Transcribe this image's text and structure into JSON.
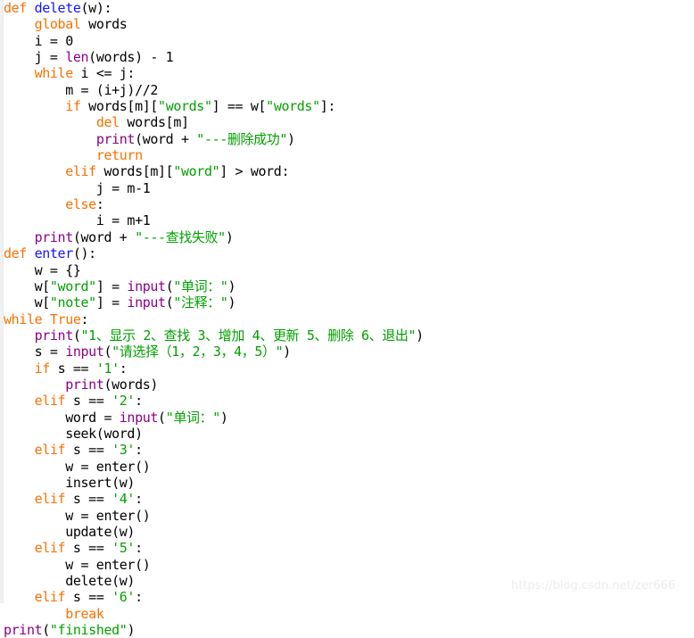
{
  "editor": {
    "background_color": "#ffffff",
    "language": "python",
    "font_size_px": 15,
    "line_height_px": 18.35
  },
  "palette": {
    "keyword": "#f77100",
    "function_name": "#1414ff",
    "builtin": "#8a008a",
    "string": "#00a000",
    "plain": "#000000",
    "watermark": "#ededed"
  },
  "watermark": {
    "text": "https://blog.csdn.net/zer666"
  },
  "code": {
    "lines": [
      {
        "n": 1,
        "tokens": [
          {
            "c": "kw",
            "t": "def"
          },
          {
            "c": "plain",
            "t": " "
          },
          {
            "c": "fname",
            "t": "delete"
          },
          {
            "c": "plain",
            "t": "(w):"
          }
        ]
      },
      {
        "n": 2,
        "tokens": [
          {
            "c": "plain",
            "t": "    "
          },
          {
            "c": "kw",
            "t": "global"
          },
          {
            "c": "plain",
            "t": " words"
          }
        ]
      },
      {
        "n": 3,
        "tokens": [
          {
            "c": "plain",
            "t": "    i = 0"
          }
        ]
      },
      {
        "n": 4,
        "tokens": [
          {
            "c": "plain",
            "t": "    j = "
          },
          {
            "c": "builtin",
            "t": "len"
          },
          {
            "c": "plain",
            "t": "(words) - 1"
          }
        ]
      },
      {
        "n": 5,
        "tokens": [
          {
            "c": "plain",
            "t": "    "
          },
          {
            "c": "kw",
            "t": "while"
          },
          {
            "c": "plain",
            "t": " i <= j:"
          }
        ]
      },
      {
        "n": 6,
        "tokens": [
          {
            "c": "plain",
            "t": "        m = (i+j)//2"
          }
        ]
      },
      {
        "n": 7,
        "tokens": [
          {
            "c": "plain",
            "t": "        "
          },
          {
            "c": "kw",
            "t": "if"
          },
          {
            "c": "plain",
            "t": " words[m]["
          },
          {
            "c": "str",
            "t": "\"words\""
          },
          {
            "c": "plain",
            "t": "] == w["
          },
          {
            "c": "str",
            "t": "\"words\""
          },
          {
            "c": "plain",
            "t": "]:"
          }
        ]
      },
      {
        "n": 8,
        "tokens": [
          {
            "c": "plain",
            "t": "            "
          },
          {
            "c": "kw",
            "t": "del"
          },
          {
            "c": "plain",
            "t": " words[m]"
          }
        ]
      },
      {
        "n": 9,
        "tokens": [
          {
            "c": "plain",
            "t": "            "
          },
          {
            "c": "builtin",
            "t": "print"
          },
          {
            "c": "plain",
            "t": "(word + "
          },
          {
            "c": "str",
            "t": "\"---删除成功\""
          },
          {
            "c": "plain",
            "t": ")"
          }
        ]
      },
      {
        "n": 10,
        "tokens": [
          {
            "c": "plain",
            "t": "            "
          },
          {
            "c": "kw",
            "t": "return"
          }
        ]
      },
      {
        "n": 11,
        "tokens": [
          {
            "c": "plain",
            "t": "        "
          },
          {
            "c": "kw",
            "t": "elif"
          },
          {
            "c": "plain",
            "t": " words[m]["
          },
          {
            "c": "str",
            "t": "\"word\""
          },
          {
            "c": "plain",
            "t": "] > word:"
          }
        ]
      },
      {
        "n": 12,
        "tokens": [
          {
            "c": "plain",
            "t": "            j = m-1"
          }
        ]
      },
      {
        "n": 13,
        "tokens": [
          {
            "c": "plain",
            "t": "        "
          },
          {
            "c": "kw",
            "t": "else"
          },
          {
            "c": "plain",
            "t": ":"
          }
        ]
      },
      {
        "n": 14,
        "tokens": [
          {
            "c": "plain",
            "t": "            i = m+1"
          }
        ]
      },
      {
        "n": 15,
        "tokens": [
          {
            "c": "plain",
            "t": "    "
          },
          {
            "c": "builtin",
            "t": "print"
          },
          {
            "c": "plain",
            "t": "(word + "
          },
          {
            "c": "str",
            "t": "\"---查找失败\""
          },
          {
            "c": "plain",
            "t": ")"
          }
        ]
      },
      {
        "n": 16,
        "tokens": [
          {
            "c": "kw",
            "t": "def"
          },
          {
            "c": "plain",
            "t": " "
          },
          {
            "c": "fname",
            "t": "enter"
          },
          {
            "c": "plain",
            "t": "():"
          }
        ]
      },
      {
        "n": 17,
        "tokens": [
          {
            "c": "plain",
            "t": "    w = {}"
          }
        ]
      },
      {
        "n": 18,
        "tokens": [
          {
            "c": "plain",
            "t": "    w["
          },
          {
            "c": "str",
            "t": "\"word\""
          },
          {
            "c": "plain",
            "t": "] = "
          },
          {
            "c": "builtin",
            "t": "input"
          },
          {
            "c": "plain",
            "t": "("
          },
          {
            "c": "str",
            "t": "\"单词：\""
          },
          {
            "c": "plain",
            "t": ")"
          }
        ]
      },
      {
        "n": 19,
        "tokens": [
          {
            "c": "plain",
            "t": "    w["
          },
          {
            "c": "str",
            "t": "\"note\""
          },
          {
            "c": "plain",
            "t": "] = "
          },
          {
            "c": "builtin",
            "t": "input"
          },
          {
            "c": "plain",
            "t": "("
          },
          {
            "c": "str",
            "t": "\"注释：\""
          },
          {
            "c": "plain",
            "t": ")"
          }
        ]
      },
      {
        "n": 20,
        "tokens": [
          {
            "c": "kw",
            "t": "while"
          },
          {
            "c": "plain",
            "t": " "
          },
          {
            "c": "kw",
            "t": "True"
          },
          {
            "c": "plain",
            "t": ":"
          }
        ]
      },
      {
        "n": 21,
        "tokens": [
          {
            "c": "plain",
            "t": "    "
          },
          {
            "c": "builtin",
            "t": "print"
          },
          {
            "c": "plain",
            "t": "("
          },
          {
            "c": "str",
            "t": "\"1、显示 2、查找 3、增加 4、更新 5、删除 6、退出\""
          },
          {
            "c": "plain",
            "t": ")"
          }
        ]
      },
      {
        "n": 22,
        "tokens": [
          {
            "c": "plain",
            "t": "    s = "
          },
          {
            "c": "builtin",
            "t": "input"
          },
          {
            "c": "plain",
            "t": "("
          },
          {
            "c": "str",
            "t": "\"请选择（1，2，3，4，5）\""
          },
          {
            "c": "plain",
            "t": ")"
          }
        ]
      },
      {
        "n": 23,
        "tokens": [
          {
            "c": "plain",
            "t": "    "
          },
          {
            "c": "kw",
            "t": "if"
          },
          {
            "c": "plain",
            "t": " s == "
          },
          {
            "c": "str",
            "t": "'1'"
          },
          {
            "c": "plain",
            "t": ":"
          }
        ]
      },
      {
        "n": 24,
        "tokens": [
          {
            "c": "plain",
            "t": "        "
          },
          {
            "c": "builtin",
            "t": "print"
          },
          {
            "c": "plain",
            "t": "(words)"
          }
        ]
      },
      {
        "n": 25,
        "tokens": [
          {
            "c": "plain",
            "t": "    "
          },
          {
            "c": "kw",
            "t": "elif"
          },
          {
            "c": "plain",
            "t": " s == "
          },
          {
            "c": "str",
            "t": "'2'"
          },
          {
            "c": "plain",
            "t": ":"
          }
        ]
      },
      {
        "n": 26,
        "tokens": [
          {
            "c": "plain",
            "t": "        word = "
          },
          {
            "c": "builtin",
            "t": "input"
          },
          {
            "c": "plain",
            "t": "("
          },
          {
            "c": "str",
            "t": "\"单词：\""
          },
          {
            "c": "plain",
            "t": ")"
          }
        ]
      },
      {
        "n": 27,
        "tokens": [
          {
            "c": "plain",
            "t": "        seek(word)"
          }
        ]
      },
      {
        "n": 28,
        "tokens": [
          {
            "c": "plain",
            "t": "    "
          },
          {
            "c": "kw",
            "t": "elif"
          },
          {
            "c": "plain",
            "t": " s == "
          },
          {
            "c": "str",
            "t": "'3'"
          },
          {
            "c": "plain",
            "t": ":"
          }
        ]
      },
      {
        "n": 29,
        "tokens": [
          {
            "c": "plain",
            "t": "        w = enter()"
          }
        ]
      },
      {
        "n": 30,
        "tokens": [
          {
            "c": "plain",
            "t": "        insert(w)"
          }
        ]
      },
      {
        "n": 31,
        "tokens": [
          {
            "c": "plain",
            "t": "    "
          },
          {
            "c": "kw",
            "t": "elif"
          },
          {
            "c": "plain",
            "t": " s == "
          },
          {
            "c": "str",
            "t": "'4'"
          },
          {
            "c": "plain",
            "t": ":"
          }
        ]
      },
      {
        "n": 32,
        "tokens": [
          {
            "c": "plain",
            "t": "        w = enter()"
          }
        ]
      },
      {
        "n": 33,
        "tokens": [
          {
            "c": "plain",
            "t": "        update(w)"
          }
        ]
      },
      {
        "n": 34,
        "tokens": [
          {
            "c": "plain",
            "t": "    "
          },
          {
            "c": "kw",
            "t": "elif"
          },
          {
            "c": "plain",
            "t": " s == "
          },
          {
            "c": "str",
            "t": "'5'"
          },
          {
            "c": "plain",
            "t": ":"
          }
        ]
      },
      {
        "n": 35,
        "tokens": [
          {
            "c": "plain",
            "t": "        w = enter()"
          }
        ]
      },
      {
        "n": 36,
        "tokens": [
          {
            "c": "plain",
            "t": "        delete(w)"
          }
        ]
      },
      {
        "n": 37,
        "tokens": [
          {
            "c": "plain",
            "t": "    "
          },
          {
            "c": "kw",
            "t": "elif"
          },
          {
            "c": "plain",
            "t": " s == "
          },
          {
            "c": "str",
            "t": "'6'"
          },
          {
            "c": "plain",
            "t": ":"
          }
        ]
      },
      {
        "n": 38,
        "tokens": [
          {
            "c": "plain",
            "t": "        "
          },
          {
            "c": "kw",
            "t": "break"
          }
        ]
      },
      {
        "n": 39,
        "tokens": [
          {
            "c": "builtin",
            "t": "print"
          },
          {
            "c": "plain",
            "t": "("
          },
          {
            "c": "str",
            "t": "\"finished\""
          },
          {
            "c": "plain",
            "t": ")"
          }
        ]
      }
    ]
  }
}
